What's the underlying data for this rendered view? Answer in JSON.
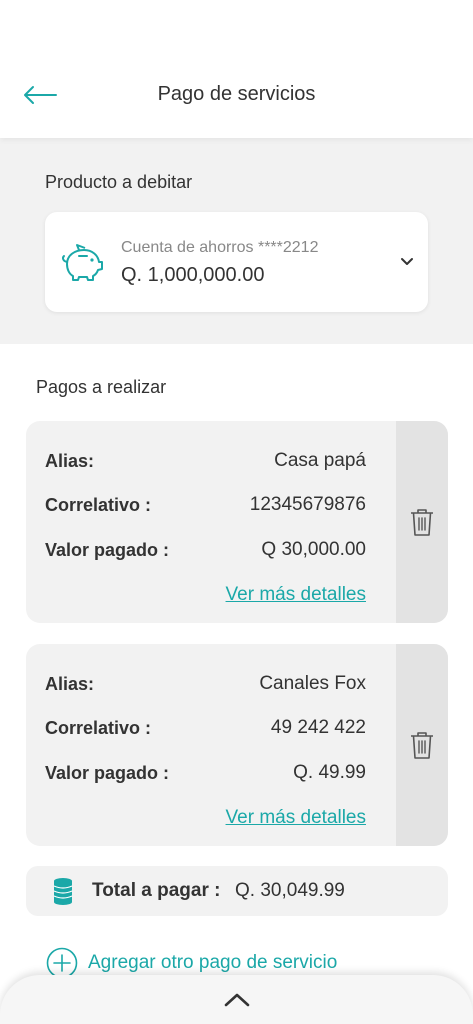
{
  "header": {
    "title": "Pago de servicios"
  },
  "debit": {
    "label": "Producto a debitar",
    "account_name": "Cuenta de ahorros ****2212",
    "account_balance": "Q. 1,000,000.00"
  },
  "payments": {
    "label": "Pagos a realizar",
    "items": [
      {
        "alias_label": "Alias:",
        "alias": "Casa papá",
        "corr_label": "Correlativo :",
        "corr": "12345679876",
        "paid_label": "Valor pagado :",
        "paid": "Q 30,000.00",
        "details": "Ver más detalles"
      },
      {
        "alias_label": "Alias:",
        "alias": "Canales Fox",
        "corr_label": "Correlativo :",
        "corr": "49 242 422",
        "paid_label": "Valor pagado :",
        "paid": "Q. 49.99",
        "details": "Ver más detalles"
      }
    ],
    "total_label": "Total a pagar :",
    "total_value": "Q. 30,049.99",
    "add_label": "Agregar otro pago de servicio"
  },
  "colors": {
    "accent": "#1ba8a8",
    "card": "#f2f2f2",
    "trash_col": "#e3e3e3"
  },
  "icons": [
    "arrow-left-icon",
    "piggy-bank-icon",
    "chevron-down-icon",
    "trash-icon",
    "coins-icon",
    "plus-circle-icon",
    "chevron-up-icon"
  ]
}
